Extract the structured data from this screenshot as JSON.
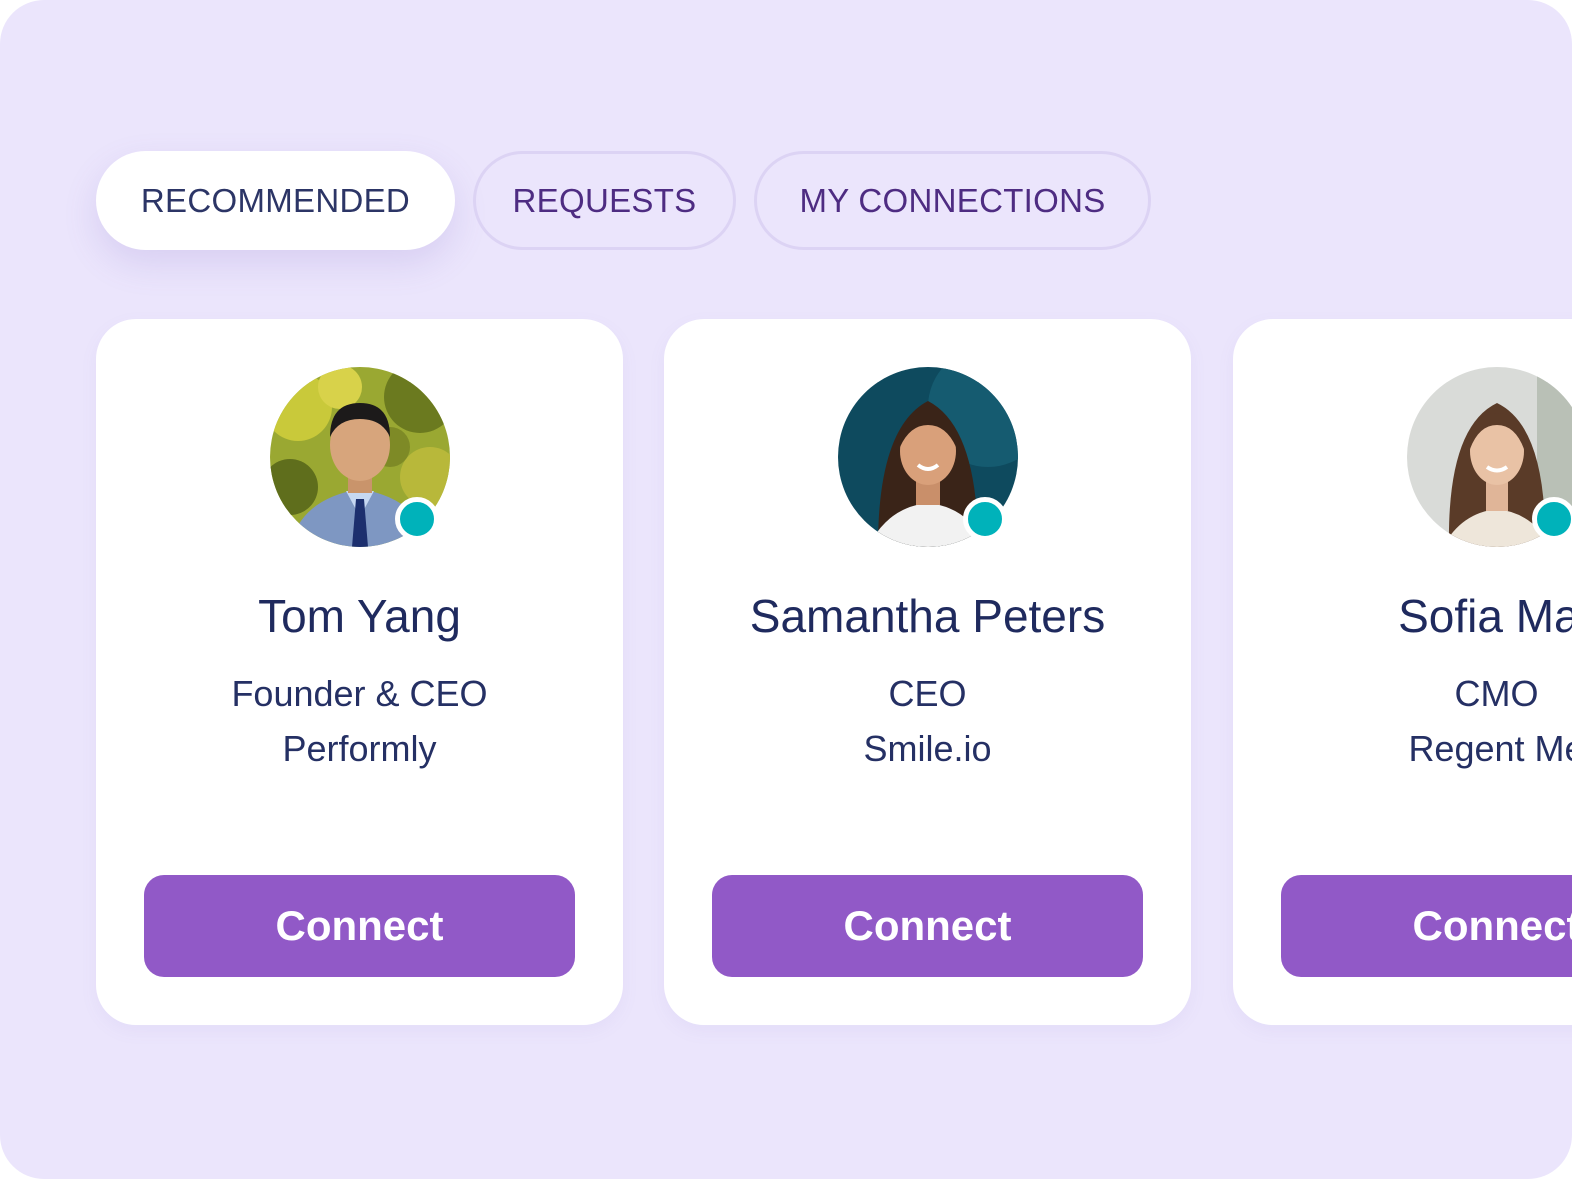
{
  "tabs": [
    {
      "label": "RECOMMENDED",
      "active": true
    },
    {
      "label": "REQUESTS",
      "active": false
    },
    {
      "label": "MY CONNECTIONS",
      "active": false
    }
  ],
  "cards": [
    {
      "name": "Tom Yang",
      "role": "Founder & CEO",
      "company": "Performly",
      "button": "Connect",
      "status": "online"
    },
    {
      "name": "Samantha Peters",
      "role": "CEO",
      "company": "Smile.io",
      "button": "Connect",
      "status": "online"
    },
    {
      "name": "Sofia Mar",
      "role": "CMO",
      "company": "Regent Me",
      "button": "Connect",
      "status": "online"
    }
  ],
  "colors": {
    "background": "#ebe5fc",
    "card": "#ffffff",
    "accent": "#9159c7",
    "status_online": "#00b2ba",
    "text_dark": "#1f2a5e",
    "tab_outline_text": "#4e2c82"
  },
  "icons": {
    "status": "online-status-dot-icon"
  }
}
